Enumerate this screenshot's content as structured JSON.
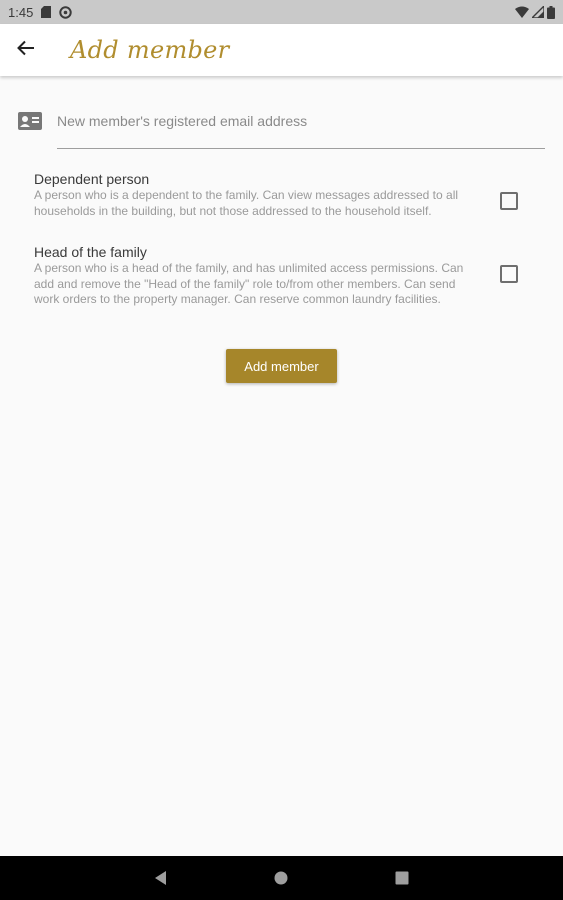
{
  "status_bar": {
    "time": "1:45",
    "icons": [
      "sd-card-icon",
      "sync-icon",
      "wifi-icon",
      "signal-icon",
      "battery-icon"
    ]
  },
  "app_bar": {
    "title": "Add member",
    "back_icon": "arrow-back-icon",
    "title_color": "#b08d2e"
  },
  "form": {
    "email_placeholder": "New member's registered email address",
    "email_value": "",
    "email_icon": "contact-card-icon",
    "roles": [
      {
        "title": "Dependent person",
        "description": "A person who is a dependent to the family. Can view messages addressed to all households in the building, but not those addressed to the household itself.",
        "checked": false
      },
      {
        "title": "Head of the family",
        "description": "A person who is a head of the family, and has unlimited access permissions. Can add and remove the \"Head of the family\" role to/from other members. Can send work orders to the property manager. Can reserve common laundry facilities.",
        "checked": false
      }
    ],
    "submit_label": "Add member",
    "accent_color": "#a6862a"
  },
  "nav_bar": {
    "buttons": [
      "back-triangle-icon",
      "home-circle-icon",
      "recents-square-icon"
    ]
  }
}
